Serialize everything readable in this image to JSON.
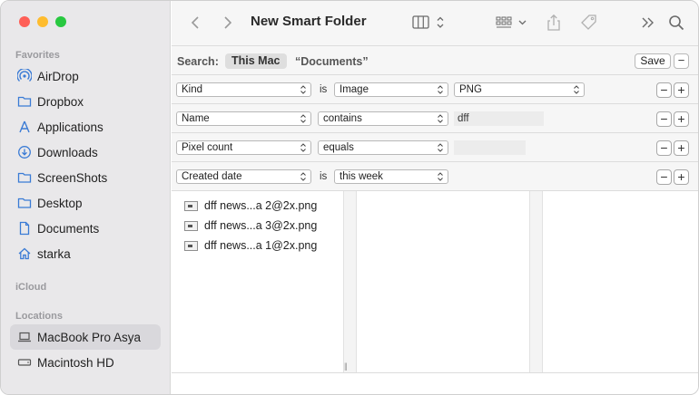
{
  "window": {
    "title": "New Smart Folder"
  },
  "sidebar": {
    "sections": {
      "favorites": "Favorites",
      "icloud": "iCloud",
      "locations": "Locations"
    },
    "favorites": [
      {
        "label": "AirDrop",
        "icon": "airdrop-icon"
      },
      {
        "label": "Dropbox",
        "icon": "folder-icon"
      },
      {
        "label": "Applications",
        "icon": "applications-icon"
      },
      {
        "label": "Downloads",
        "icon": "downloads-icon"
      },
      {
        "label": "ScreenShots",
        "icon": "folder-icon"
      },
      {
        "label": "Desktop",
        "icon": "folder-icon"
      },
      {
        "label": "Documents",
        "icon": "document-icon"
      },
      {
        "label": "starka",
        "icon": "home-icon"
      }
    ],
    "locations": [
      {
        "label": "MacBook Pro Asya",
        "icon": "laptop-icon",
        "selected": true
      },
      {
        "label": "Macintosh HD",
        "icon": "disk-icon"
      }
    ]
  },
  "search": {
    "label": "Search:",
    "scope_selected": "This Mac",
    "scope_other": "“Documents”",
    "save_label": "Save",
    "minus_label": "−"
  },
  "criteria": [
    {
      "attribute": "Kind",
      "connector": "is",
      "operator": "Image",
      "value_popup": "PNG"
    },
    {
      "attribute": "Name",
      "connector": "",
      "operator": "contains",
      "value_text": "dff"
    },
    {
      "attribute": "Pixel count",
      "connector": "",
      "operator": "equals",
      "value_text": ""
    },
    {
      "attribute": "Created date",
      "connector": "is",
      "operator": "this week"
    }
  ],
  "buttons": {
    "minus": "−",
    "plus": "+"
  },
  "results": [
    "dff news...a 2@2x.png",
    "dff news...a 3@2x.png",
    "dff news...a 1@2x.png"
  ],
  "colors": {
    "close": "#fe5f57",
    "minimize": "#febc2e",
    "maximize": "#28c840",
    "sidebar_bg": "#e9e8ea",
    "sidebar_icon": "#3a7bd5"
  }
}
